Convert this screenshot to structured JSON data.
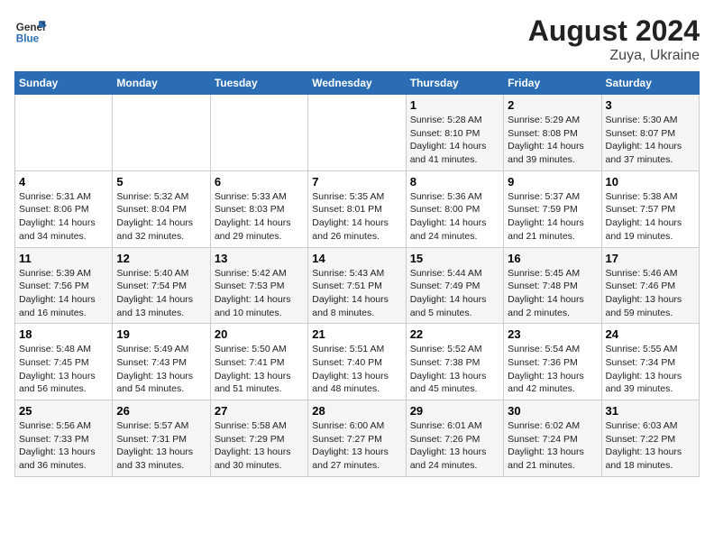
{
  "header": {
    "logo_general": "General",
    "logo_blue": "Blue",
    "title": "August 2024",
    "subtitle": "Zuya, Ukraine"
  },
  "days_of_week": [
    "Sunday",
    "Monday",
    "Tuesday",
    "Wednesday",
    "Thursday",
    "Friday",
    "Saturday"
  ],
  "weeks": [
    {
      "days": [
        {
          "number": "",
          "info": ""
        },
        {
          "number": "",
          "info": ""
        },
        {
          "number": "",
          "info": ""
        },
        {
          "number": "",
          "info": ""
        },
        {
          "number": "1",
          "info": "Sunrise: 5:28 AM\nSunset: 8:10 PM\nDaylight: 14 hours\nand 41 minutes."
        },
        {
          "number": "2",
          "info": "Sunrise: 5:29 AM\nSunset: 8:08 PM\nDaylight: 14 hours\nand 39 minutes."
        },
        {
          "number": "3",
          "info": "Sunrise: 5:30 AM\nSunset: 8:07 PM\nDaylight: 14 hours\nand 37 minutes."
        }
      ]
    },
    {
      "days": [
        {
          "number": "4",
          "info": "Sunrise: 5:31 AM\nSunset: 8:06 PM\nDaylight: 14 hours\nand 34 minutes."
        },
        {
          "number": "5",
          "info": "Sunrise: 5:32 AM\nSunset: 8:04 PM\nDaylight: 14 hours\nand 32 minutes."
        },
        {
          "number": "6",
          "info": "Sunrise: 5:33 AM\nSunset: 8:03 PM\nDaylight: 14 hours\nand 29 minutes."
        },
        {
          "number": "7",
          "info": "Sunrise: 5:35 AM\nSunset: 8:01 PM\nDaylight: 14 hours\nand 26 minutes."
        },
        {
          "number": "8",
          "info": "Sunrise: 5:36 AM\nSunset: 8:00 PM\nDaylight: 14 hours\nand 24 minutes."
        },
        {
          "number": "9",
          "info": "Sunrise: 5:37 AM\nSunset: 7:59 PM\nDaylight: 14 hours\nand 21 minutes."
        },
        {
          "number": "10",
          "info": "Sunrise: 5:38 AM\nSunset: 7:57 PM\nDaylight: 14 hours\nand 19 minutes."
        }
      ]
    },
    {
      "days": [
        {
          "number": "11",
          "info": "Sunrise: 5:39 AM\nSunset: 7:56 PM\nDaylight: 14 hours\nand 16 minutes."
        },
        {
          "number": "12",
          "info": "Sunrise: 5:40 AM\nSunset: 7:54 PM\nDaylight: 14 hours\nand 13 minutes."
        },
        {
          "number": "13",
          "info": "Sunrise: 5:42 AM\nSunset: 7:53 PM\nDaylight: 14 hours\nand 10 minutes."
        },
        {
          "number": "14",
          "info": "Sunrise: 5:43 AM\nSunset: 7:51 PM\nDaylight: 14 hours\nand 8 minutes."
        },
        {
          "number": "15",
          "info": "Sunrise: 5:44 AM\nSunset: 7:49 PM\nDaylight: 14 hours\nand 5 minutes."
        },
        {
          "number": "16",
          "info": "Sunrise: 5:45 AM\nSunset: 7:48 PM\nDaylight: 14 hours\nand 2 minutes."
        },
        {
          "number": "17",
          "info": "Sunrise: 5:46 AM\nSunset: 7:46 PM\nDaylight: 13 hours\nand 59 minutes."
        }
      ]
    },
    {
      "days": [
        {
          "number": "18",
          "info": "Sunrise: 5:48 AM\nSunset: 7:45 PM\nDaylight: 13 hours\nand 56 minutes."
        },
        {
          "number": "19",
          "info": "Sunrise: 5:49 AM\nSunset: 7:43 PM\nDaylight: 13 hours\nand 54 minutes."
        },
        {
          "number": "20",
          "info": "Sunrise: 5:50 AM\nSunset: 7:41 PM\nDaylight: 13 hours\nand 51 minutes."
        },
        {
          "number": "21",
          "info": "Sunrise: 5:51 AM\nSunset: 7:40 PM\nDaylight: 13 hours\nand 48 minutes."
        },
        {
          "number": "22",
          "info": "Sunrise: 5:52 AM\nSunset: 7:38 PM\nDaylight: 13 hours\nand 45 minutes."
        },
        {
          "number": "23",
          "info": "Sunrise: 5:54 AM\nSunset: 7:36 PM\nDaylight: 13 hours\nand 42 minutes."
        },
        {
          "number": "24",
          "info": "Sunrise: 5:55 AM\nSunset: 7:34 PM\nDaylight: 13 hours\nand 39 minutes."
        }
      ]
    },
    {
      "days": [
        {
          "number": "25",
          "info": "Sunrise: 5:56 AM\nSunset: 7:33 PM\nDaylight: 13 hours\nand 36 minutes."
        },
        {
          "number": "26",
          "info": "Sunrise: 5:57 AM\nSunset: 7:31 PM\nDaylight: 13 hours\nand 33 minutes."
        },
        {
          "number": "27",
          "info": "Sunrise: 5:58 AM\nSunset: 7:29 PM\nDaylight: 13 hours\nand 30 minutes."
        },
        {
          "number": "28",
          "info": "Sunrise: 6:00 AM\nSunset: 7:27 PM\nDaylight: 13 hours\nand 27 minutes."
        },
        {
          "number": "29",
          "info": "Sunrise: 6:01 AM\nSunset: 7:26 PM\nDaylight: 13 hours\nand 24 minutes."
        },
        {
          "number": "30",
          "info": "Sunrise: 6:02 AM\nSunset: 7:24 PM\nDaylight: 13 hours\nand 21 minutes."
        },
        {
          "number": "31",
          "info": "Sunrise: 6:03 AM\nSunset: 7:22 PM\nDaylight: 13 hours\nand 18 minutes."
        }
      ]
    }
  ]
}
